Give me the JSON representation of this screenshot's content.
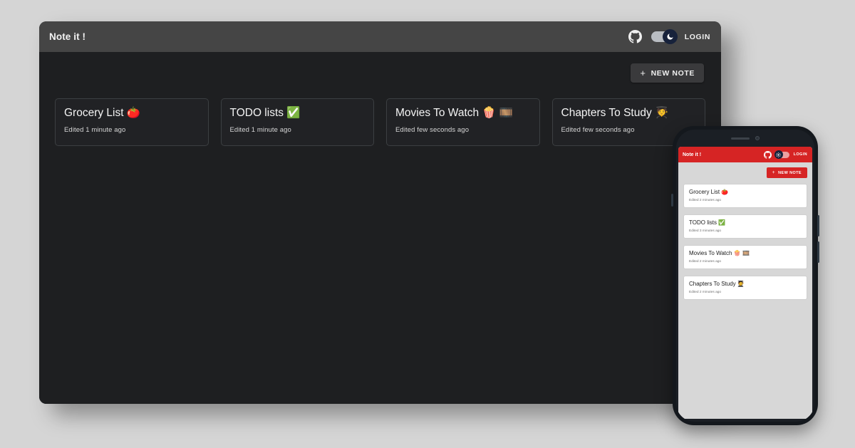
{
  "page": {
    "background_color": "#d5d5d5"
  },
  "desktop": {
    "title": "Note it !",
    "header": {
      "github_icon": "github-icon",
      "theme_toggle": {
        "state": "dark",
        "icon": "moon-icon",
        "track_color": "#b9bdc2",
        "knob_color": "#17223b"
      },
      "login_label": "LOGIN"
    },
    "new_note_button": {
      "label": "NEW NOTE",
      "icon": "plus-icon",
      "background_color": "#3a3a3c"
    },
    "notes": [
      {
        "title": "Grocery List",
        "emoji": "🍅",
        "subtitle": "Edited 1 minute ago"
      },
      {
        "title": "TODO lists",
        "emoji": "✅",
        "subtitle": "Edited 1 minute ago"
      },
      {
        "title": "Movies To Watch",
        "emoji": "🍿 🎞️",
        "subtitle": "Edited few seconds ago"
      },
      {
        "title": "Chapters To Study",
        "emoji": "🧑‍🎓",
        "subtitle": "Edited few seconds ago"
      }
    ],
    "colors": {
      "header_bar": "#454545",
      "body": "#1e1f21",
      "card_border": "#3c3f42"
    }
  },
  "phone": {
    "title": "Note it !",
    "header": {
      "github_icon": "github-icon",
      "theme_toggle": {
        "state": "light",
        "icon": "sun-icon",
        "track_color": "#eba0a0",
        "knob_color": "#17223b"
      },
      "login_label": "LOGIN",
      "background_color": "#d62424"
    },
    "new_note_button": {
      "label": "NEW NOTE",
      "icon": "plus-icon",
      "background_color": "#d62424"
    },
    "notes": [
      {
        "title": "Grocery List",
        "emoji": "🍅",
        "subtitle": "Edited 2 minutes ago"
      },
      {
        "title": "TODO lists",
        "emoji": "✅",
        "subtitle": "Edited 3 minutes ago"
      },
      {
        "title": "Movies To Watch",
        "emoji": "🍿 🎞️",
        "subtitle": "Edited 2 minutes ago"
      },
      {
        "title": "Chapters To Study",
        "emoji": "🧑‍🎓",
        "subtitle": "Edited 2 minutes ago"
      }
    ],
    "colors": {
      "screen_background": "#d7d7d7",
      "card_background": "#ffffff",
      "bezel": "#14181d"
    }
  }
}
